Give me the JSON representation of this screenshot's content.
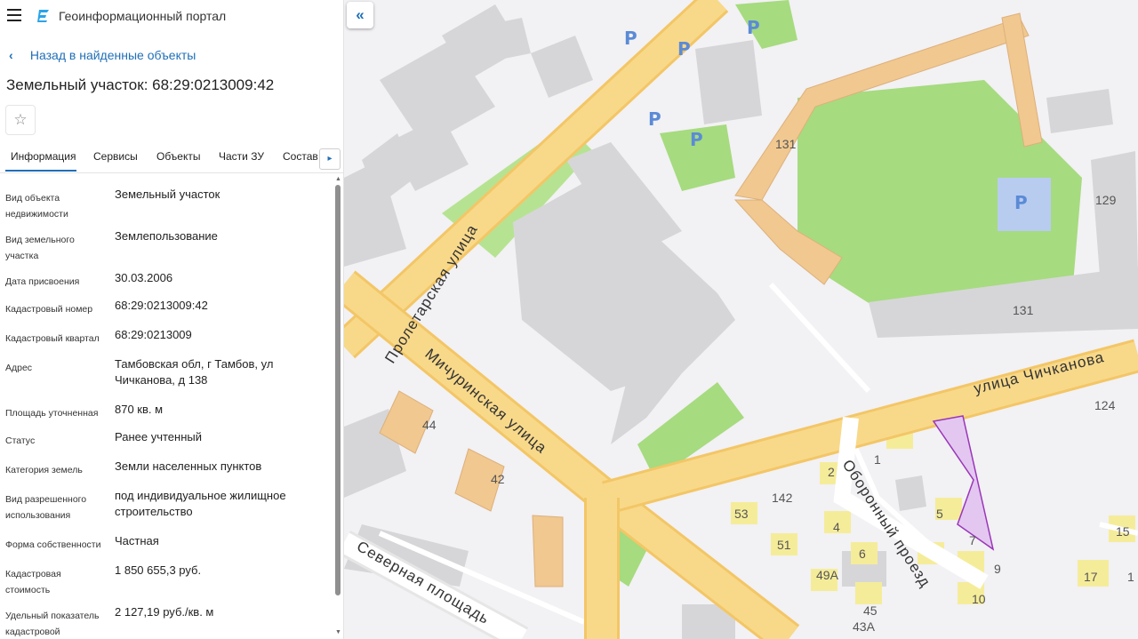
{
  "app": {
    "title": "Геоинформационный портал"
  },
  "nav": {
    "back_label": "Назад в найденные объекты"
  },
  "object": {
    "title": "Земельный участок: 68:29:0213009:42"
  },
  "tabs": [
    {
      "label": "Информация"
    },
    {
      "label": "Сервисы"
    },
    {
      "label": "Объекты"
    },
    {
      "label": "Части ЗУ"
    },
    {
      "label": "Состав"
    }
  ],
  "icons": {
    "menu": "hamburger-icon",
    "logo": "portal-logo-icon",
    "back": "chevron-left-icon",
    "favorite": "star-icon",
    "tabs_next": "chevron-right-icon",
    "collapse": "double-chevron-left-icon"
  },
  "properties": [
    {
      "label": "Вид объекта недвижимости",
      "value": "Земельный участок"
    },
    {
      "label": "Вид земельного участка",
      "value": "Землепользование"
    },
    {
      "label": "Дата присвоения",
      "value": "30.03.2006"
    },
    {
      "label": "Кадастровый номер",
      "value": "68:29:0213009:42"
    },
    {
      "label": "Кадастровый квартал",
      "value": "68:29:0213009"
    },
    {
      "label": "Адрес",
      "value": "Тамбовская обл, г Тамбов, ул Чичканова, д 138"
    },
    {
      "label": "Площадь уточненная",
      "value": "870 кв. м"
    },
    {
      "label": "Статус",
      "value": "Ранее учтенный"
    },
    {
      "label": "Категория земель",
      "value": "Земли населенных пунктов"
    },
    {
      "label": "Вид разрешенного использования",
      "value": "под индивидуальное жилищное строительство"
    },
    {
      "label": "Форма собственности",
      "value": "Частная"
    },
    {
      "label": "Кадастровая стоимость",
      "value": "1 850 655,3 руб."
    },
    {
      "label": "Удельный показатель кадастровой",
      "value": "2 127,19 руб./кв. м"
    }
  ],
  "map": {
    "streets": [
      "Пролетарская улица",
      "Мичуринская улица",
      "улица Чичканова",
      "Оборонный проезд",
      "Северная площадь"
    ],
    "building_numbers": [
      "131",
      "131",
      "129",
      "124",
      "44",
      "42",
      "1",
      "2",
      "142",
      "53",
      "4",
      "5",
      "7",
      "51",
      "6",
      "9",
      "49А",
      "10",
      "45",
      "43А",
      "15",
      "17",
      "1"
    ],
    "parking_label": "P",
    "colors": {
      "road": "#f8d98a",
      "green": "#a6db7f",
      "parcel": "#e3c7f0",
      "parcel_border": "#9a36b8",
      "building": "#d4d4d4",
      "orange_building": "#f0c890",
      "yellow_building": "#f5ec9a"
    }
  }
}
